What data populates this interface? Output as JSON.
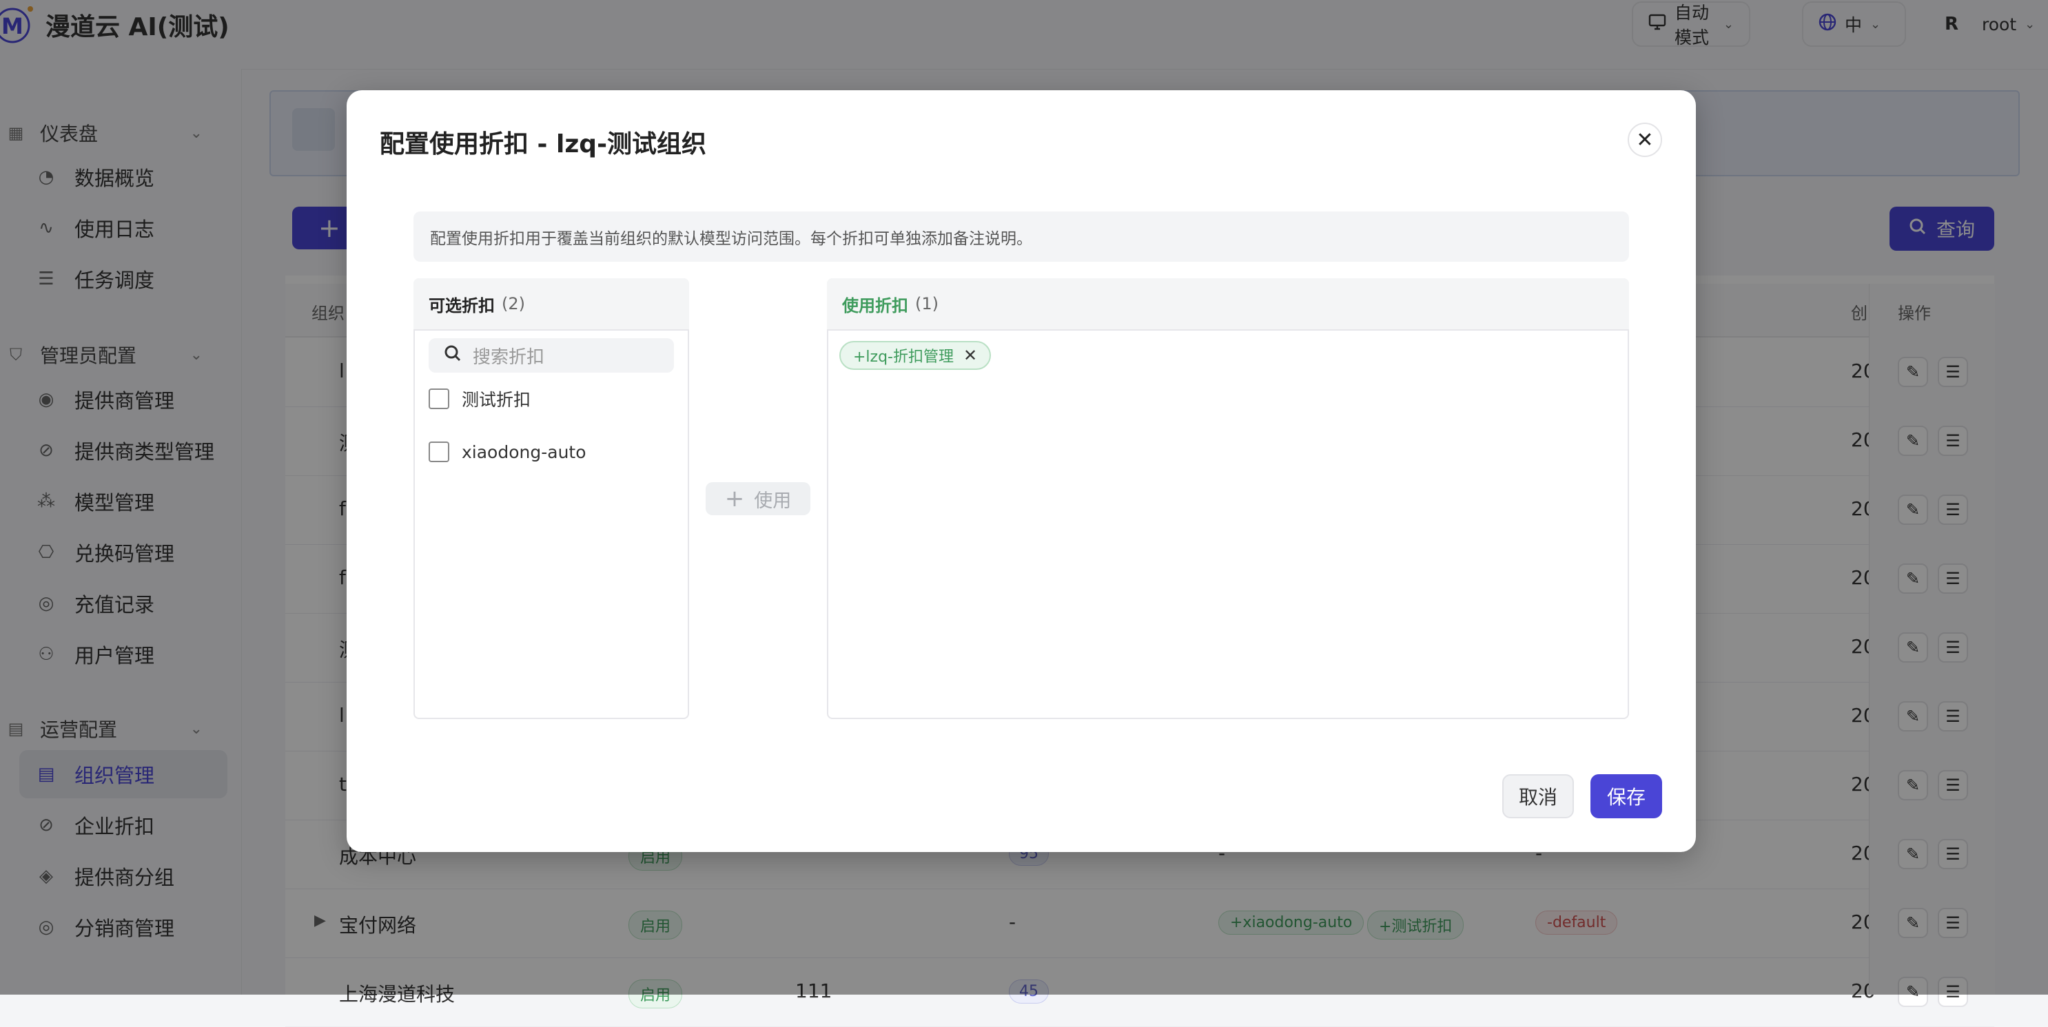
{
  "header": {
    "app_title": "漫道云 AI(测试)",
    "mode_label": "自动模式",
    "lang_label": "中",
    "user_initial": "R",
    "user_name": "root"
  },
  "sidebar": {
    "sections": [
      {
        "label": "仪表盘",
        "icon": "dashboard-icon",
        "items": [
          {
            "label": "数据概览",
            "icon": "gauge-icon"
          },
          {
            "label": "使用日志",
            "icon": "activity-icon"
          },
          {
            "label": "任务调度",
            "icon": "list-check-icon"
          }
        ]
      },
      {
        "label": "管理员配置",
        "icon": "shield-icon",
        "items": [
          {
            "label": "提供商管理",
            "icon": "broadcast-icon"
          },
          {
            "label": "提供商类型管理",
            "icon": "discount-icon"
          },
          {
            "label": "模型管理",
            "icon": "boxes-icon"
          },
          {
            "label": "兑换码管理",
            "icon": "ticket-icon"
          },
          {
            "label": "充值记录",
            "icon": "user-circle-icon"
          },
          {
            "label": "用户管理",
            "icon": "user-gear-icon"
          }
        ]
      },
      {
        "label": "运营配置",
        "icon": "building-icon",
        "items": [
          {
            "label": "组织管理",
            "icon": "building-icon",
            "active": true
          },
          {
            "label": "企业折扣",
            "icon": "discount-icon"
          },
          {
            "label": "提供商分组",
            "icon": "layers-icon"
          },
          {
            "label": "分销商管理",
            "icon": "user-circle-icon"
          }
        ]
      }
    ]
  },
  "page": {
    "add_label": "+",
    "query_label": "查询",
    "table_headers": {
      "org": "组织",
      "created": "创",
      "actions": "操作"
    },
    "rows": [
      {
        "name": "l",
        "created": "20"
      },
      {
        "name": "测",
        "created": "20"
      },
      {
        "name": "f",
        "created": "20"
      },
      {
        "name": "f",
        "created": "20"
      },
      {
        "name": "测",
        "created": "20"
      },
      {
        "name": "l",
        "created": "20"
      },
      {
        "name": "t",
        "created": "20"
      },
      {
        "name": "成本中心",
        "status": "启用",
        "count": "95",
        "discounts": "-",
        "default": "-",
        "created": "20"
      },
      {
        "name": "宝付网络",
        "status": "启用",
        "count": "-",
        "tags": [
          "+xiaodong-auto",
          "+测试折扣"
        ],
        "default": "-default",
        "created": "20"
      },
      {
        "name": "上海漫道科技",
        "status": "启用",
        "num": "111",
        "count": "45",
        "created": "20"
      }
    ]
  },
  "modal": {
    "title": "配置使用折扣 - lzq-测试组织",
    "notice": "配置使用折扣用于覆盖当前组织的默认模型访问范围。每个折扣可单独添加备注说明。",
    "available": {
      "title": "可选折扣",
      "count": "(2)",
      "search_placeholder": "搜索折扣",
      "items": [
        "测试折扣",
        "xiaodong-auto"
      ]
    },
    "use_button": "使用",
    "selected": {
      "title": "使用折扣",
      "count": "(1)",
      "chips": [
        "+lzq-折扣管理"
      ]
    },
    "cancel_label": "取消",
    "save_label": "保存"
  },
  "colors": {
    "primary": "#4a45d6",
    "success": "#3e9b5c",
    "danger": "#d05050"
  }
}
